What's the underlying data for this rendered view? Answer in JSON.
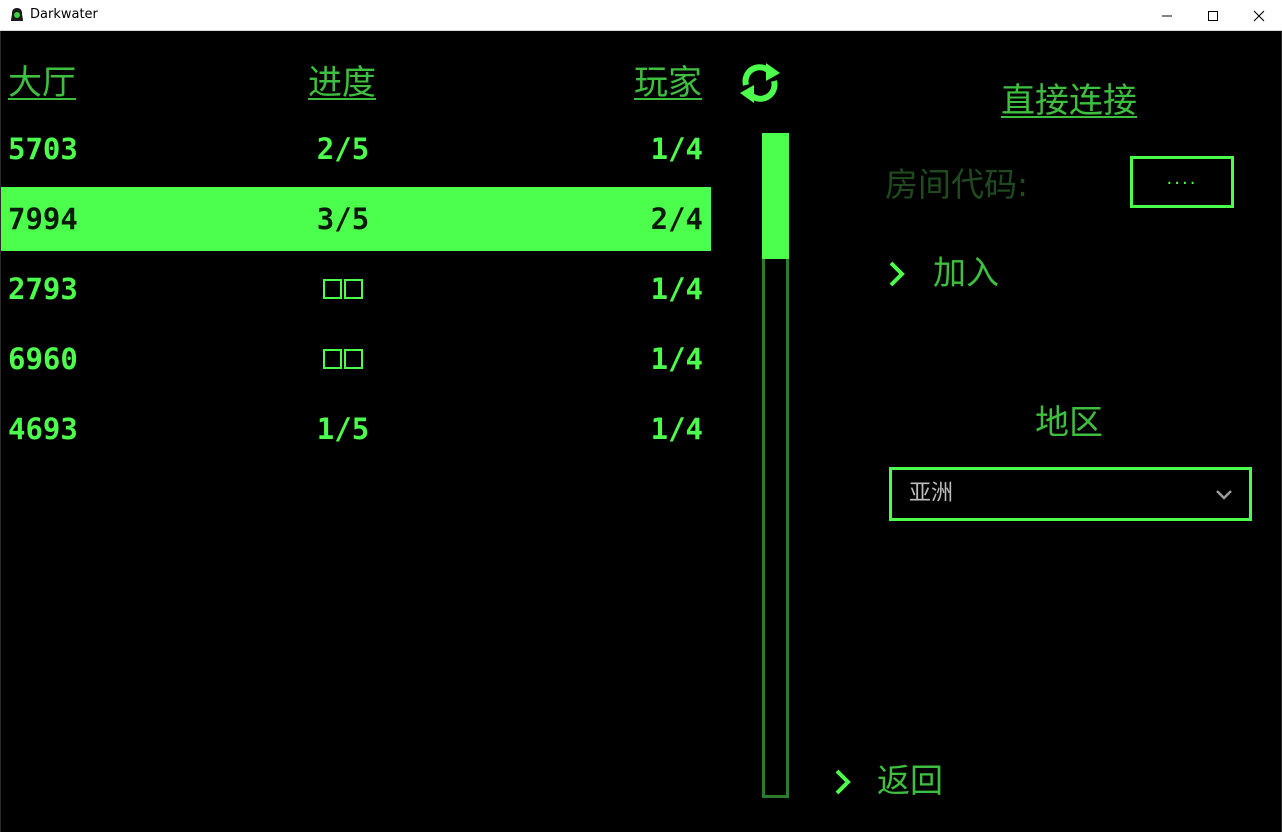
{
  "window": {
    "title": "Darkwater"
  },
  "lobby_table": {
    "headers": {
      "lobby": "大厅",
      "progress": "进度",
      "players": "玩家"
    },
    "rows": [
      {
        "id": "5703",
        "progress": "2/5",
        "players": "1/4",
        "selected": false
      },
      {
        "id": "7994",
        "progress": "3/5",
        "players": "2/4",
        "selected": true
      },
      {
        "id": "2793",
        "progress": "",
        "players": "1/4",
        "selected": false
      },
      {
        "id": "6960",
        "progress": "",
        "players": "1/4",
        "selected": false
      },
      {
        "id": "4693",
        "progress": "1/5",
        "players": "1/4",
        "selected": false
      }
    ]
  },
  "scrollbar": {
    "position": 0,
    "visible_fraction": 0.19
  },
  "direct_connect": {
    "title": "直接连接",
    "room_code_label": "房间代码:",
    "room_code_value": "....",
    "join_label": "加入"
  },
  "region": {
    "label": "地区",
    "selected": "亚洲"
  },
  "back_label": "返回",
  "colors": {
    "accent": "#4dff4d",
    "accent_dim": "#3fbf3f",
    "disabled_text": "#1f4a1f",
    "scroll_track": "#2d7a2d",
    "background": "#000000"
  },
  "icons": {
    "refresh": "refresh-icon",
    "join": "chevron-right-icon",
    "back": "chevron-right-icon",
    "dropdown": "chevron-down-icon"
  }
}
